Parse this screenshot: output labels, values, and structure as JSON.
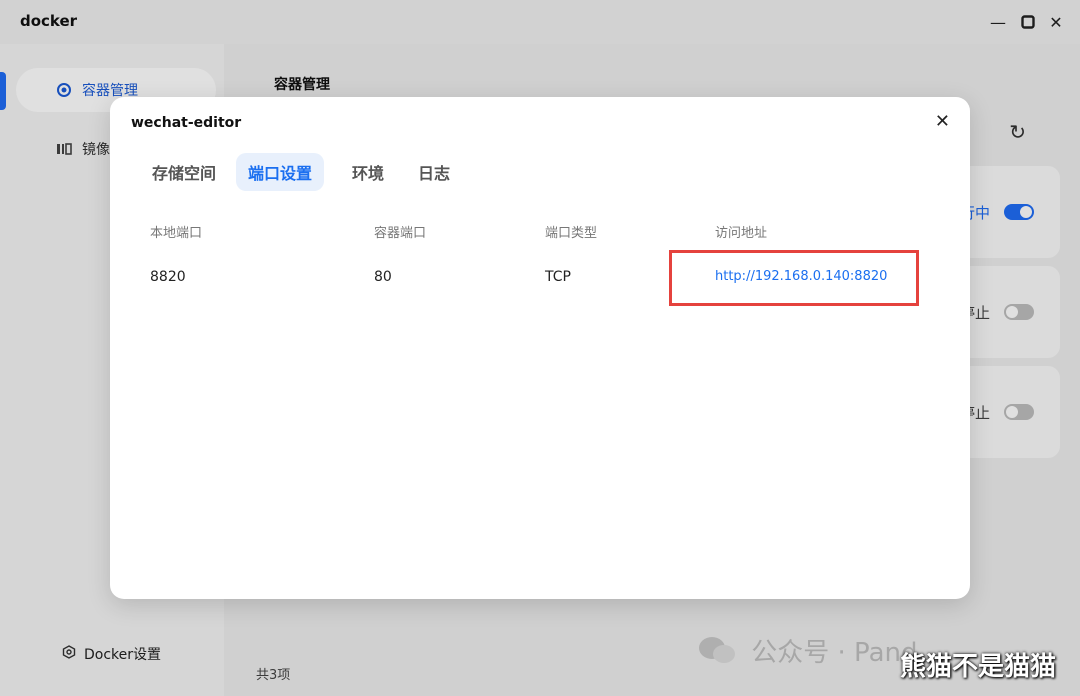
{
  "window": {
    "title": "docker",
    "minimize": "—",
    "maximize": "▢",
    "close": "✕"
  },
  "sidebar": {
    "items": [
      {
        "label": "容器管理",
        "icon": "gear-icon"
      },
      {
        "label": "镜像",
        "icon": "image-icon"
      }
    ],
    "settings": "Docker设置"
  },
  "main": {
    "title": "容器管理",
    "cards": [
      {
        "status": "行中",
        "toggle_on": true
      },
      {
        "status": "停止",
        "toggle_on": false
      },
      {
        "status": "停止",
        "toggle_on": false
      }
    ],
    "count": "共3项"
  },
  "dialog": {
    "title": "wechat-editor",
    "close": "✕",
    "tabs": [
      "存储空间",
      "端口设置",
      "环境",
      "日志"
    ],
    "active_tab": "端口设置",
    "columns": [
      "本地端口",
      "容器端口",
      "端口类型",
      "访问地址"
    ],
    "rows": [
      {
        "local_port": "8820",
        "container_port": "80",
        "type": "TCP",
        "url": "http://192.168.0.140:8820"
      }
    ]
  },
  "watermark": {
    "text": "公众号 · Pand",
    "overlay": "熊猫不是猫猫"
  },
  "colors": {
    "accent": "#1f6df5",
    "highlight": "#e5423d"
  }
}
